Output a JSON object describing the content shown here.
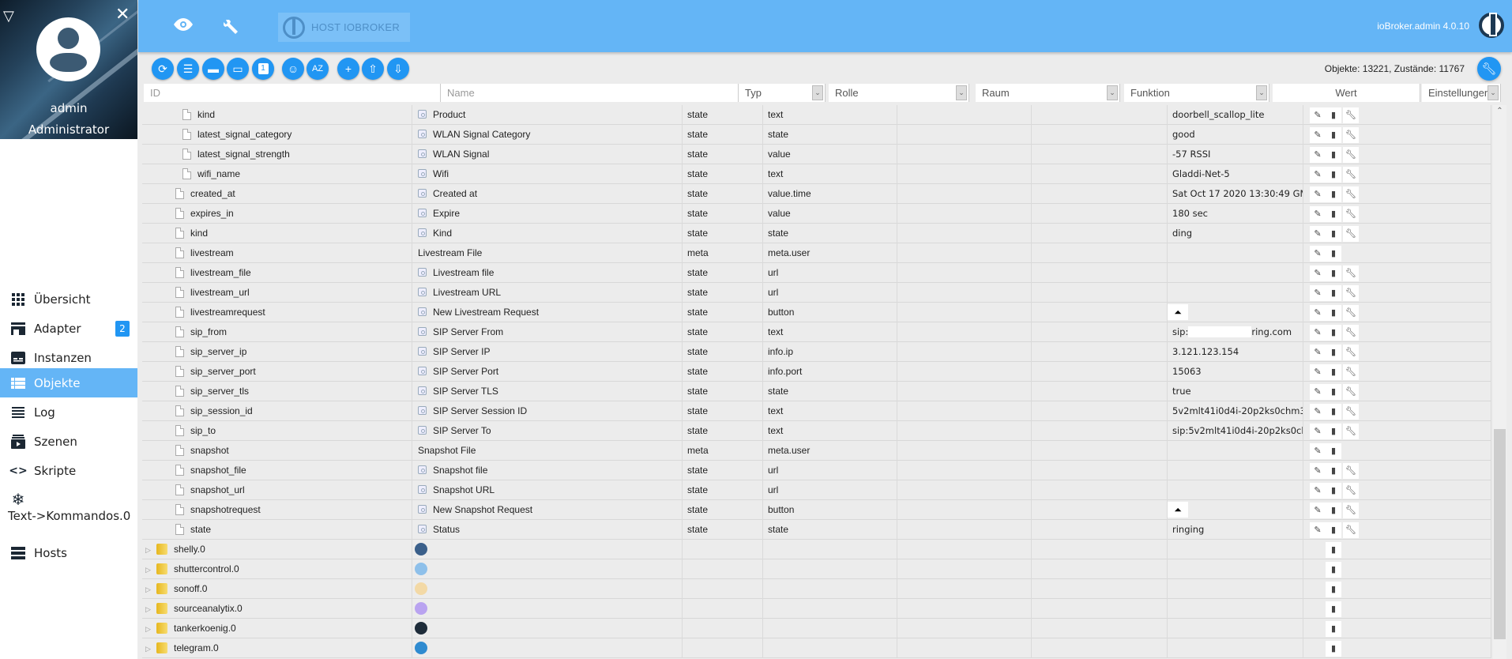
{
  "sidebar": {
    "user_name": "admin",
    "user_role": "Administrator",
    "items": [
      {
        "label": "Übersicht",
        "icon": "grid-icon"
      },
      {
        "label": "Adapter",
        "icon": "store-icon",
        "badge": "2"
      },
      {
        "label": "Instanzen",
        "icon": "instances-icon"
      },
      {
        "label": "Objekte",
        "icon": "list-icon",
        "active": true
      },
      {
        "label": "Log",
        "icon": "log-icon"
      },
      {
        "label": "Szenen",
        "icon": "scenes-icon"
      },
      {
        "label": "Skripte",
        "icon": "code-icon"
      },
      {
        "label": "Text->Kommandos.0",
        "icon": "snowflake-icon"
      },
      {
        "label": "Hosts",
        "icon": "hosts-icon"
      }
    ]
  },
  "topbar": {
    "host_label": "HOST IOBROKER",
    "version": "ioBroker.admin 4.0.10"
  },
  "toolbar": {
    "buttons": [
      "refresh",
      "list-view",
      "folder-closed",
      "folder-open",
      "counter-1",
      "customs-user",
      "sort-az",
      "add",
      "upload",
      "download"
    ],
    "counts": "Objekte: 13221, Zustände: 11767"
  },
  "columns": {
    "id": "ID",
    "name": "Name",
    "type": "Typ",
    "role": "Rolle",
    "room": "Raum",
    "function": "Funktion",
    "value": "Wert",
    "settings": "Einstellungen"
  },
  "rows": [
    {
      "id": "kind",
      "indent": 2,
      "name": "Product",
      "type": "state",
      "role": "text",
      "value": "doorbell_scallop_lite",
      "actions": [
        "edit",
        "delete",
        "settings"
      ]
    },
    {
      "id": "latest_signal_category",
      "indent": 2,
      "name": "WLAN Signal Category",
      "type": "state",
      "role": "state",
      "value": "good",
      "actions": [
        "edit",
        "delete",
        "settings"
      ]
    },
    {
      "id": "latest_signal_strength",
      "indent": 2,
      "name": "WLAN Signal",
      "type": "state",
      "role": "value",
      "value": "-57 RSSI",
      "actions": [
        "edit",
        "delete",
        "settings"
      ]
    },
    {
      "id": "wifi_name",
      "indent": 2,
      "name": "Wifi",
      "type": "state",
      "role": "text",
      "value": "Gladdi-Net-5",
      "actions": [
        "edit",
        "delete",
        "settings"
      ]
    },
    {
      "id": "created_at",
      "indent": 1,
      "name": "Created at",
      "type": "state",
      "role": "value.time",
      "value": "Sat Oct 17 2020 13:30:49 GM",
      "actions": [
        "edit",
        "delete",
        "settings"
      ]
    },
    {
      "id": "expires_in",
      "indent": 1,
      "name": "Expire",
      "type": "state",
      "role": "value",
      "value": "180 sec",
      "actions": [
        "edit",
        "delete",
        "settings"
      ]
    },
    {
      "id": "kind",
      "indent": 1,
      "name": "Kind",
      "type": "state",
      "role": "state",
      "value": "ding",
      "actions": [
        "edit",
        "delete",
        "settings"
      ]
    },
    {
      "id": "livestream",
      "indent": 1,
      "name": "Livestream File",
      "plain": true,
      "type": "meta",
      "role": "meta.user",
      "value": "",
      "actions": [
        "edit",
        "delete"
      ]
    },
    {
      "id": "livestream_file",
      "indent": 1,
      "name": "Livestream file",
      "type": "state",
      "role": "url",
      "value": "",
      "actions": [
        "edit",
        "delete",
        "settings"
      ]
    },
    {
      "id": "livestream_url",
      "indent": 1,
      "name": "Livestream URL",
      "type": "state",
      "role": "url",
      "value": "",
      "actions": [
        "edit",
        "delete",
        "settings"
      ]
    },
    {
      "id": "livestreamrequest",
      "indent": 1,
      "name": "New Livestream Request",
      "type": "state",
      "role": "button",
      "value": "",
      "button": true,
      "actions": [
        "edit",
        "delete",
        "settings"
      ]
    },
    {
      "id": "sip_from",
      "indent": 1,
      "name": "SIP Server From",
      "type": "state",
      "role": "text",
      "value": "sip:",
      "value_suffix": "ring.com",
      "redacted": true,
      "actions": [
        "edit",
        "delete",
        "settings"
      ]
    },
    {
      "id": "sip_server_ip",
      "indent": 1,
      "name": "SIP Server IP",
      "type": "state",
      "role": "info.ip",
      "value": "3.121.123.154",
      "actions": [
        "edit",
        "delete",
        "settings"
      ]
    },
    {
      "id": "sip_server_port",
      "indent": 1,
      "name": "SIP Server Port",
      "type": "state",
      "role": "info.port",
      "value": "15063",
      "actions": [
        "edit",
        "delete",
        "settings"
      ]
    },
    {
      "id": "sip_server_tls",
      "indent": 1,
      "name": "SIP Server TLS",
      "type": "state",
      "role": "state",
      "value": "true",
      "actions": [
        "edit",
        "delete",
        "settings"
      ]
    },
    {
      "id": "sip_session_id",
      "indent": 1,
      "name": "SIP Server Session ID",
      "type": "state",
      "role": "text",
      "value": "5v2mlt41i0d4i-20p2ks0chm3",
      "actions": [
        "edit",
        "delete",
        "settings"
      ]
    },
    {
      "id": "sip_to",
      "indent": 1,
      "name": "SIP Server To",
      "type": "state",
      "role": "text",
      "value": "sip:5v2mlt41i0d4i-20p2ks0ch",
      "actions": [
        "edit",
        "delete",
        "settings"
      ]
    },
    {
      "id": "snapshot",
      "indent": 1,
      "name": "Snapshot File",
      "plain": true,
      "type": "meta",
      "role": "meta.user",
      "value": "",
      "actions": [
        "edit",
        "delete"
      ]
    },
    {
      "id": "snapshot_file",
      "indent": 1,
      "name": "Snapshot file",
      "type": "state",
      "role": "url",
      "value": "",
      "actions": [
        "edit",
        "delete",
        "settings"
      ]
    },
    {
      "id": "snapshot_url",
      "indent": 1,
      "name": "Snapshot URL",
      "type": "state",
      "role": "url",
      "value": "",
      "actions": [
        "edit",
        "delete",
        "settings"
      ]
    },
    {
      "id": "snapshotrequest",
      "indent": 1,
      "name": "New Snapshot Request",
      "type": "state",
      "role": "button",
      "value": "",
      "button": true,
      "actions": [
        "edit",
        "delete",
        "settings"
      ]
    },
    {
      "id": "state",
      "indent": 1,
      "name": "Status",
      "type": "state",
      "role": "state",
      "value": "ringing",
      "actions": [
        "edit",
        "delete",
        "settings"
      ]
    },
    {
      "id": "shelly.0",
      "folder": true,
      "adapter_icon": "shelly-icon",
      "adapter_color": "#3a5f8a",
      "actions": [
        "delete"
      ]
    },
    {
      "id": "shuttercontrol.0",
      "folder": true,
      "adapter_icon": "shuttercontrol-icon",
      "adapter_color": "#8ec0ea",
      "actions": [
        "delete"
      ]
    },
    {
      "id": "sonoff.0",
      "folder": true,
      "adapter_icon": "sonoff-icon",
      "adapter_color": "#f3d9a6",
      "actions": [
        "delete"
      ]
    },
    {
      "id": "sourceanalytix.0",
      "folder": true,
      "adapter_icon": "sourceanalytix-icon",
      "adapter_color": "#b9a3f0",
      "actions": [
        "delete"
      ]
    },
    {
      "id": "tankerkoenig.0",
      "folder": true,
      "adapter_icon": "tankerkoenig-icon",
      "adapter_color": "#1e2c3a",
      "actions": [
        "delete"
      ]
    },
    {
      "id": "telegram.0",
      "folder": true,
      "adapter_icon": "telegram-icon",
      "adapter_color": "#2f8bd0",
      "actions": [
        "delete"
      ]
    }
  ]
}
